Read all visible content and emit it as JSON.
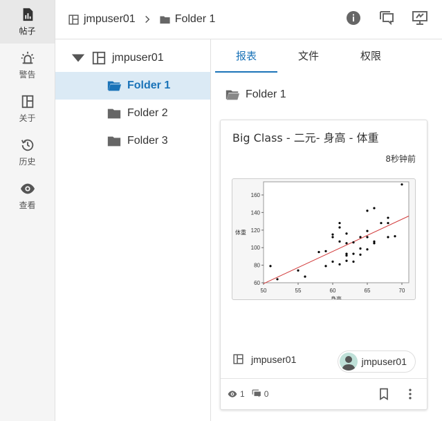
{
  "rail": {
    "items": [
      {
        "label": "帖子",
        "icon": "posts-icon"
      },
      {
        "label": "警告",
        "icon": "alert-icon"
      },
      {
        "label": "关于",
        "icon": "about-icon"
      },
      {
        "label": "历史",
        "icon": "history-icon"
      },
      {
        "label": "查看",
        "icon": "view-icon"
      }
    ]
  },
  "breadcrumb": {
    "root": "jmpuser01",
    "current": "Folder 1"
  },
  "tree": {
    "root": "jmpuser01",
    "children": [
      "Folder 1",
      "Folder 2",
      "Folder 3"
    ]
  },
  "tabs": [
    "报表",
    "文件",
    "权限"
  ],
  "folder_title": "Folder 1",
  "card": {
    "title": "Big Class - 二元- 身高 - 体重",
    "time": "8秒钟前",
    "owner": "jmpuser01",
    "author": "jmpuser01",
    "views": "1",
    "comments": "0"
  },
  "chart_data": {
    "type": "scatter",
    "ylabel": "体重",
    "xlabel": "身高",
    "x_ticks": [
      "50",
      "55",
      "60",
      "65",
      "70"
    ],
    "y_ticks": [
      "60",
      "80",
      "100",
      "120",
      "140",
      "160"
    ],
    "xlim": [
      50,
      71
    ],
    "ylim": [
      60,
      175
    ],
    "points": [
      [
        51,
        79
      ],
      [
        52,
        64
      ],
      [
        55,
        74
      ],
      [
        56,
        67
      ],
      [
        58,
        95
      ],
      [
        59,
        96
      ],
      [
        59,
        79
      ],
      [
        60,
        84
      ],
      [
        60,
        112
      ],
      [
        60,
        115
      ],
      [
        61,
        81
      ],
      [
        61,
        107
      ],
      [
        61,
        123
      ],
      [
        61,
        128
      ],
      [
        62,
        85
      ],
      [
        62,
        91
      ],
      [
        62,
        93
      ],
      [
        62,
        105
      ],
      [
        62,
        116
      ],
      [
        63,
        84
      ],
      [
        63,
        93
      ],
      [
        63,
        106
      ],
      [
        64,
        92
      ],
      [
        64,
        99
      ],
      [
        64,
        112
      ],
      [
        65,
        98
      ],
      [
        65,
        112
      ],
      [
        65,
        119
      ],
      [
        65,
        142
      ],
      [
        66,
        105
      ],
      [
        66,
        107
      ],
      [
        66,
        145
      ],
      [
        67,
        128
      ],
      [
        68,
        112
      ],
      [
        68,
        128
      ],
      [
        68,
        134
      ],
      [
        69,
        113
      ],
      [
        70,
        172
      ]
    ],
    "fit_line": {
      "x": [
        50,
        71
      ],
      "y": [
        59,
        136
      ],
      "color": "#d23b3b"
    },
    "point_color": "#000000"
  },
  "colors": {
    "accent": "#1a73b8",
    "selected_bg": "#dbeaf5",
    "icon": "#5f5f5f"
  }
}
